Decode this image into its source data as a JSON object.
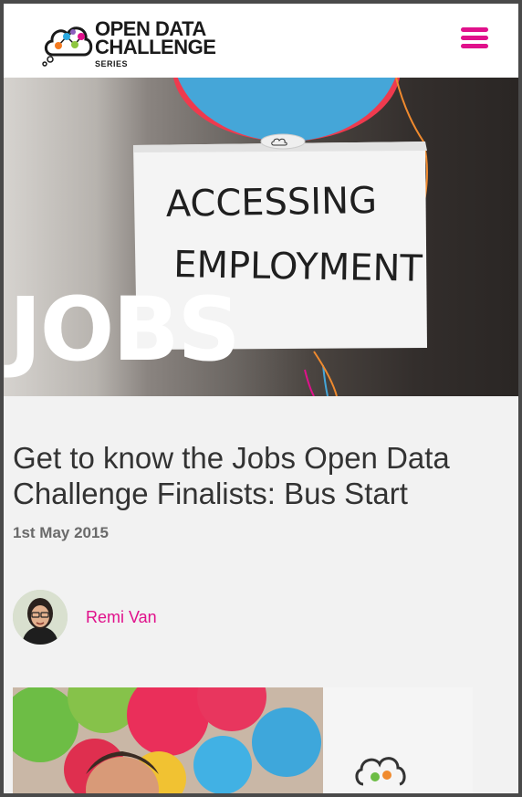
{
  "header": {
    "logo": {
      "line1": "OPEN DATA",
      "line2": "CHALLENGE",
      "sub": "SERIES"
    },
    "menu_icon": "hamburger-menu-icon"
  },
  "hero": {
    "word": "JOBS",
    "sign_line1": "ACCESSING",
    "sign_line2": "EMPLOYMENT"
  },
  "article": {
    "title": "Get to know the Jobs Open Data Challenge Finalists: Bus Start",
    "date": "1st May 2015",
    "author": "Remi Van"
  },
  "colors": {
    "accent": "#e0118b",
    "background": "#f2f2f2",
    "header": "#ffffff",
    "title_text": "#333333",
    "date_text": "#6a6a6a"
  }
}
